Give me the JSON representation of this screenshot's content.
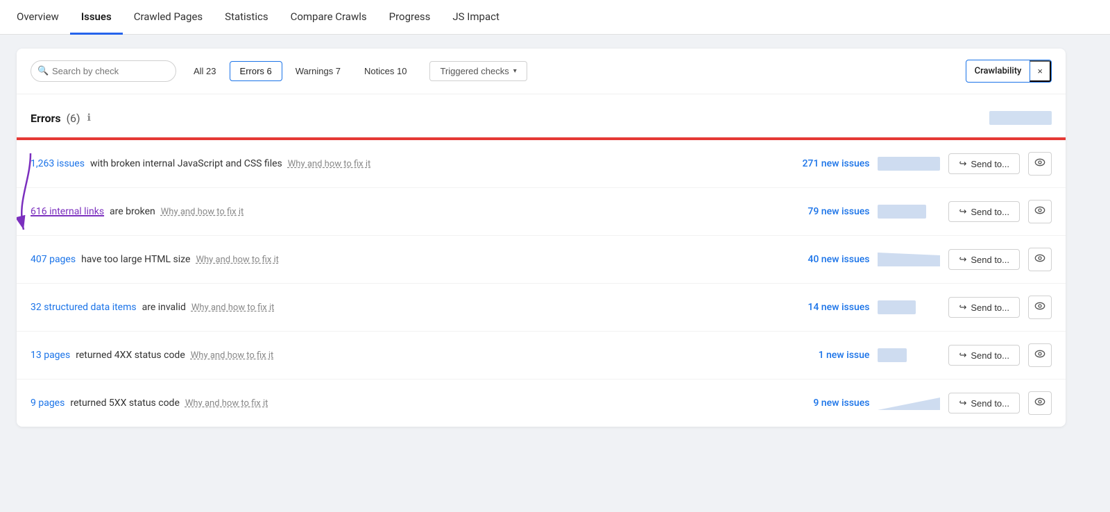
{
  "nav": {
    "items": [
      {
        "label": "Overview",
        "active": false
      },
      {
        "label": "Issues",
        "active": true
      },
      {
        "label": "Crawled Pages",
        "active": false
      },
      {
        "label": "Statistics",
        "active": false
      },
      {
        "label": "Compare Crawls",
        "active": false
      },
      {
        "label": "Progress",
        "active": false
      },
      {
        "label": "JS Impact",
        "active": false
      }
    ]
  },
  "filter": {
    "search_placeholder": "Search by check",
    "tabs": [
      {
        "label": "All 23",
        "active": false
      },
      {
        "label": "Errors 6",
        "active": true
      },
      {
        "label": "Warnings 7",
        "active": false
      },
      {
        "label": "Notices 10",
        "active": false
      }
    ],
    "triggered_label": "Triggered checks",
    "crawlability_label": "Crawlability",
    "close_label": "×"
  },
  "errors_section": {
    "title": "Errors",
    "count": "(6)",
    "info_icon": "ℹ"
  },
  "issues": [
    {
      "link_text": "1,263 issues",
      "link_color": "blue",
      "description": " with broken internal JavaScript and CSS files",
      "fix_label": "Why and how to fix it",
      "new_count": "271 new issues",
      "send_label": "Send to...",
      "chart_type": "rectangle",
      "chart_color": "#b3c9e8"
    },
    {
      "link_text": "616 internal links",
      "link_color": "purple",
      "description": " are broken",
      "fix_label": "Why and how to fix it",
      "new_count": "79 new issues",
      "send_label": "Send to...",
      "chart_type": "rectangle",
      "chart_color": "#b3c9e8"
    },
    {
      "link_text": "407 pages",
      "link_color": "blue",
      "description": " have too large HTML size",
      "fix_label": "Why and how to fix it",
      "new_count": "40 new issues",
      "send_label": "Send to...",
      "chart_type": "trapezoid",
      "chart_color": "#b3c9e8"
    },
    {
      "link_text": "32 structured data items",
      "link_color": "blue",
      "description": " are invalid",
      "fix_label": "Why and how to fix it",
      "new_count": "14 new issues",
      "send_label": "Send to...",
      "chart_type": "rectangle",
      "chart_color": "#b3c9e8"
    },
    {
      "link_text": "13 pages",
      "link_color": "blue",
      "description": " returned 4XX status code",
      "fix_label": "Why and how to fix it",
      "new_count": "1 new issue",
      "send_label": "Send to...",
      "chart_type": "rectangle",
      "chart_color": "#b3c9e8"
    },
    {
      "link_text": "9 pages",
      "link_color": "blue",
      "description": " returned 5XX status code",
      "fix_label": "Why and how to fix it",
      "new_count": "9 new issues",
      "send_label": "Send to...",
      "chart_type": "triangle",
      "chart_color": "#b3c9e8"
    }
  ],
  "icons": {
    "search": "🔍",
    "send": "↪",
    "eye": "👁",
    "chevron": "▾",
    "close": "×"
  }
}
